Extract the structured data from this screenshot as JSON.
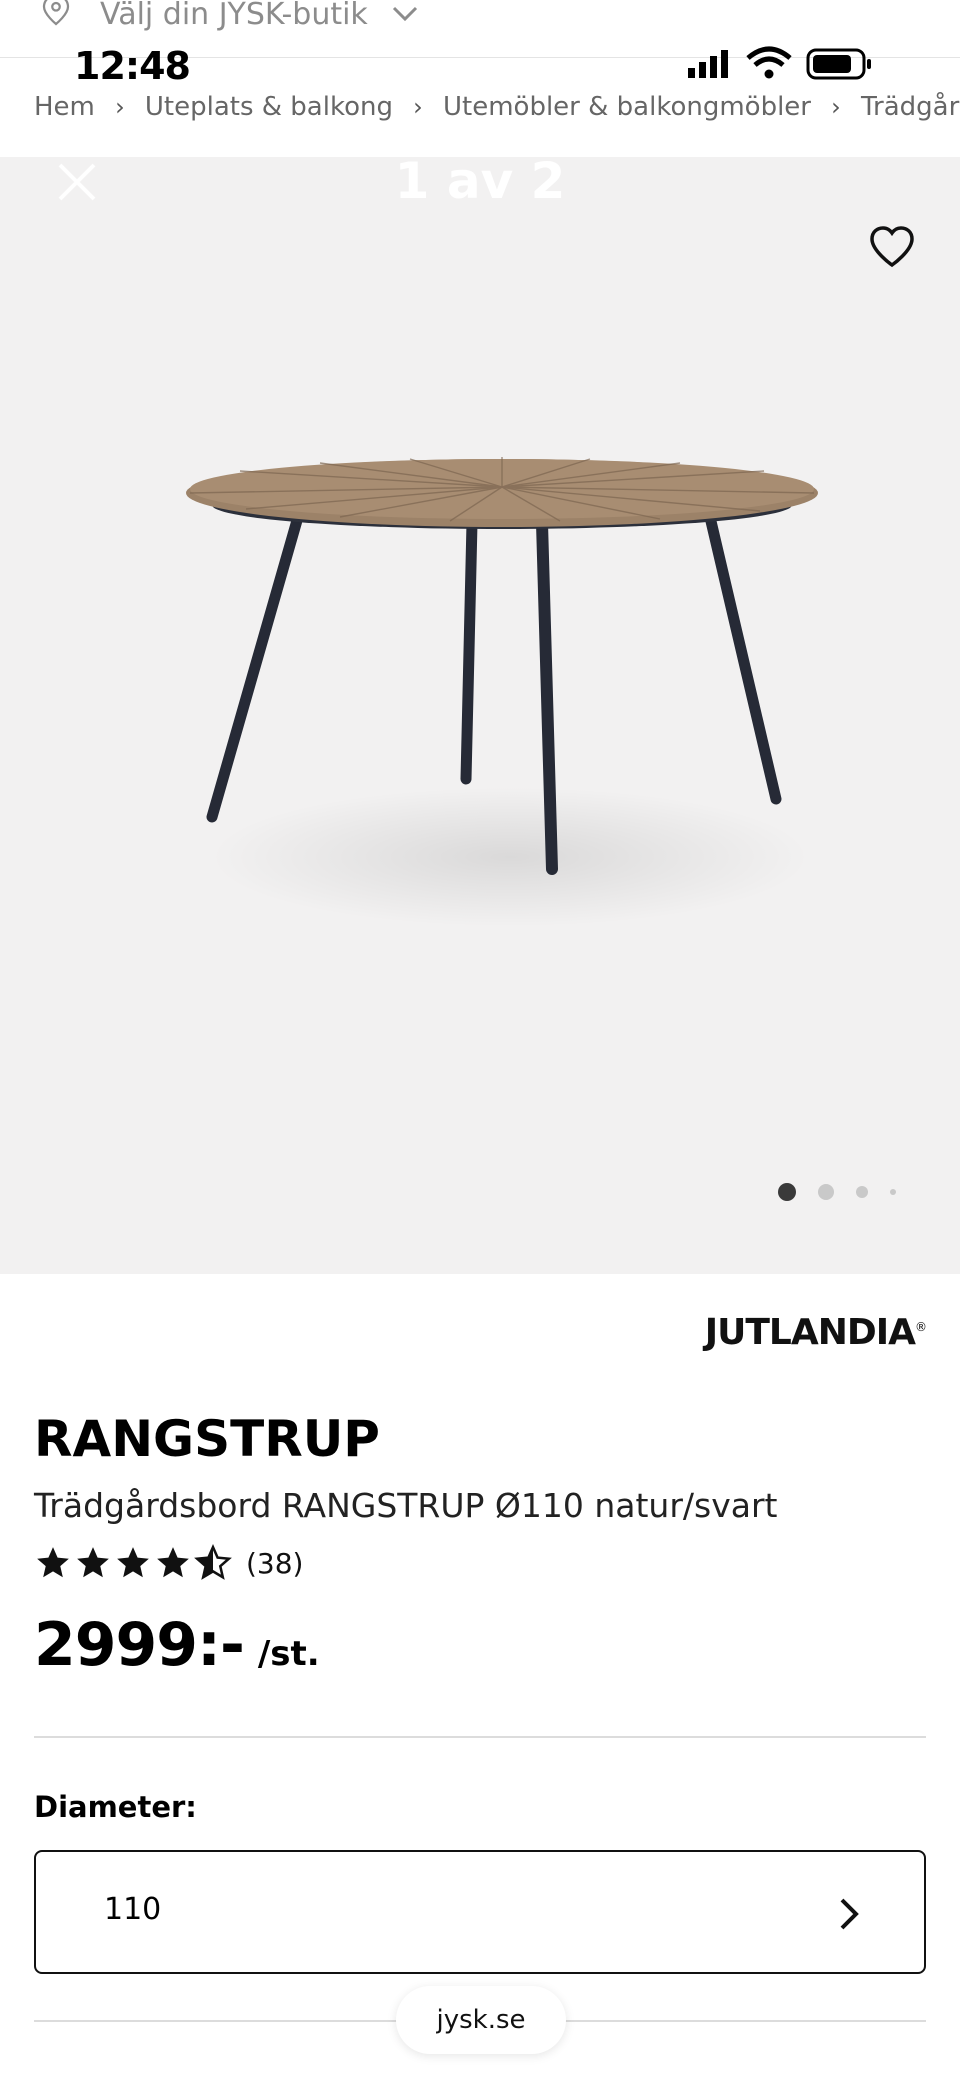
{
  "store_bar": {
    "text": "Välj din JYSK-butik",
    "icon": "location-pin-icon"
  },
  "status_bar": {
    "time": "12:48",
    "icons": [
      "cellular-signal-icon",
      "wifi-icon",
      "battery-icon"
    ]
  },
  "breadcrumb": {
    "items": [
      "Hem",
      "Uteplats & balkong",
      "Utemöbler & balkongmöbler",
      "Trädgår"
    ],
    "separator": "›"
  },
  "gallery": {
    "counter": "1 av 2",
    "image_count": 4,
    "active_index": 0
  },
  "product": {
    "brand": "JUTLANDIA",
    "brand_mark": "®",
    "title": "RANGSTRUP",
    "subtitle": "Trädgårdsbord RANGSTRUP Ø110 natur/svart",
    "rating_value": 4.5,
    "rating_count": "(38)",
    "price": "2999:-",
    "price_unit": "/st."
  },
  "options": {
    "diameter_label": "Diameter:",
    "diameter_value": "110"
  },
  "browser": {
    "url": "jysk.se"
  },
  "colors": {
    "text": "#111111",
    "muted": "#8c8c8c",
    "gallery_bg": "#f2f1f1",
    "border": "#111111",
    "divider": "#dcdcdc"
  }
}
